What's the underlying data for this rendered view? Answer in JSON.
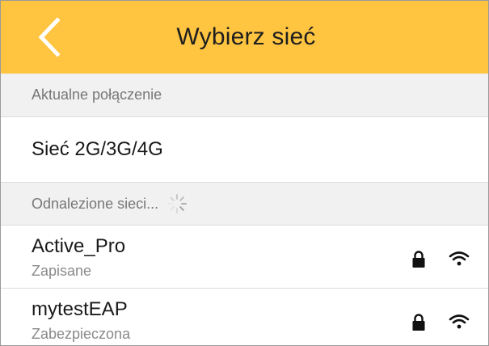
{
  "header": {
    "title": "Wybierz sieć",
    "back_icon": "chevron-left-icon",
    "background": "#ffc440"
  },
  "current_section": {
    "label": "Aktualne połączenie"
  },
  "current_connection": {
    "label": "Sieć 2G/3G/4G"
  },
  "found_section": {
    "label": "Odnalezione sieci...",
    "spinner_icon": "loading-spinner-icon"
  },
  "networks": [
    {
      "name": "Active_Pro",
      "status": "Zapisane",
      "lock_icon": "lock-icon",
      "signal_icon": "wifi-icon"
    },
    {
      "name": "mytestEAP",
      "status": "Zabezpieczona",
      "lock_icon": "lock-icon",
      "signal_icon": "wifi-icon"
    }
  ]
}
